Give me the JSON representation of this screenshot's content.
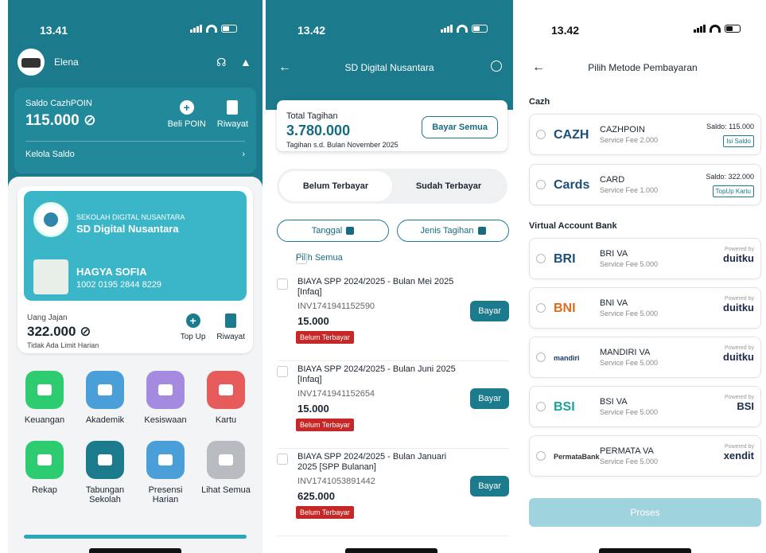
{
  "home": {
    "time": "13.41",
    "user": "Elena",
    "saldo_label": "Saldo CazhPOIN",
    "saldo_value": "115.000",
    "beli_poin": "Beli POIN",
    "riwayat": "Riwayat",
    "kelola_saldo": "Kelola Saldo",
    "school_sub": "SEKOLAH DIGITAL NUSANTARA",
    "school_name": "SD Digital Nusantara",
    "student_name": "HAGYA SOFIA",
    "student_id": "1002 0195 2844 8229",
    "uang_label": "Uang Jajan",
    "uang_value": "322.000",
    "uang_note": "Tidak Ada Limit Harian",
    "top_up": "Top Up",
    "riwayat2": "Riwayat",
    "menu": [
      {
        "label": "Keuangan",
        "color": "#2ecc71"
      },
      {
        "label": "Akademik",
        "color": "#4a9fd8"
      },
      {
        "label": "Kesiswaan",
        "color": "#a58be0"
      },
      {
        "label": "Kartu",
        "color": "#e85b5b"
      },
      {
        "label": "Rekap",
        "color": "#2ecc71"
      },
      {
        "label": "Tabungan Sekolah",
        "color": "#1b7a8c"
      },
      {
        "label": "Presensi Harian",
        "color": "#4a9fd8"
      },
      {
        "label": "Lihat Semua",
        "color": "#b8bcc0"
      }
    ]
  },
  "tagihan": {
    "time": "13.42",
    "title": "SD Digital Nusantara",
    "total_label": "Total Tagihan",
    "total_value": "3.780.000",
    "total_note": "Tagihan s.d. Bulan November 2025",
    "bayar_semua": "Bayar Semua",
    "tab_belum": "Belum Terbayar",
    "tab_sudah": "Sudah Terbayar",
    "filter_tanggal": "Tanggal",
    "filter_jenis": "Jenis Tagihan",
    "pilih_semua": "Pilih Semua",
    "items": [
      {
        "title": "BIAYA SPP 2024/2025 - Bulan Mei 2025 [Infaq]",
        "inv": "INV1741941152590",
        "amount": "15.000",
        "status": "Belum Terbayar",
        "action": "Bayar"
      },
      {
        "title": "BIAYA SPP 2024/2025 - Bulan Juni 2025 [Infaq]",
        "inv": "INV1741941152654",
        "amount": "15.000",
        "status": "Belum Terbayar",
        "action": "Bayar"
      },
      {
        "title": "BIAYA SPP 2024/2025 - Bulan Januari 2025 [SPP Bulanan]",
        "inv": "INV1741053891442",
        "amount": "625.000",
        "status": "Belum Terbayar",
        "action": "Bayar"
      }
    ]
  },
  "payment": {
    "time": "13.42",
    "title": "Pilih Metode Pembayaran",
    "section_cazh": "Cazh",
    "section_va": "Virtual Account Bank",
    "proses": "Proses",
    "cazh": [
      {
        "logo": "CAZH",
        "name": "CAZHPOIN",
        "fee": "Service Fee 2.000",
        "saldo": "Saldo: 115.000",
        "tag": "Isi Saldo"
      },
      {
        "logo": "Cards",
        "name": "CARD",
        "fee": "Service Fee 1.000",
        "saldo": "Saldo: 322.000",
        "tag": "TopUp Kartu"
      }
    ],
    "va": [
      {
        "logo": "BRI",
        "name": "BRI VA",
        "fee": "Service Fee 5.000",
        "powered": "Powered by",
        "brand": "duitku"
      },
      {
        "logo": "BNI",
        "name": "BNI VA",
        "fee": "Service Fee 5.000",
        "powered": "Powered by",
        "brand": "duitku"
      },
      {
        "logo": "mandiri",
        "name": "MANDIRI VA",
        "fee": "Service Fee 5.000",
        "powered": "Powered by",
        "brand": "duitku"
      },
      {
        "logo": "BSI",
        "name": "BSI VA",
        "fee": "Service Fee 5.000",
        "powered": "Powered by",
        "brand": "BSI"
      },
      {
        "logo": "PermataBank",
        "name": "PERMATA VA",
        "fee": "Service Fee 5.000",
        "powered": "Powered by",
        "brand": "xendit"
      }
    ]
  }
}
